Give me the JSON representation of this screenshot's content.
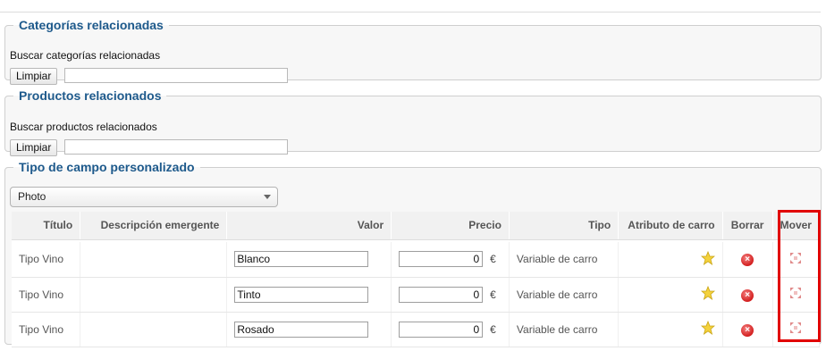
{
  "related_categories": {
    "legend": "Categorías relacionadas",
    "search_label": "Buscar categorías relacionadas",
    "clear_label": "Limpiar",
    "search_value": ""
  },
  "related_products": {
    "legend": "Productos relacionados",
    "search_label": "Buscar productos relacionados",
    "clear_label": "Limpiar",
    "search_value": ""
  },
  "custom_field": {
    "legend": "Tipo de campo personalizado",
    "selected_type": "Photo",
    "columns": {
      "title": "Título",
      "tooltip": "Descripción emergente",
      "value": "Valor",
      "price": "Precio",
      "type": "Tipo",
      "cart_attribute": "Atributo de carro",
      "delete": "Borrar",
      "move": "Mover"
    },
    "rows": [
      {
        "title": "Tipo Vino",
        "tooltip": "",
        "value": "Blanco",
        "price": "0",
        "currency": "€",
        "type": "Variable de carro"
      },
      {
        "title": "Tipo Vino",
        "tooltip": "",
        "value": "Tinto",
        "price": "0",
        "currency": "€",
        "type": "Variable de carro"
      },
      {
        "title": "Tipo Vino",
        "tooltip": "",
        "value": "Rosado",
        "price": "0",
        "currency": "€",
        "type": "Variable de carro"
      }
    ],
    "icons": {
      "cart_attribute": "star-icon",
      "delete": "delete-icon",
      "move": "move-icon"
    },
    "colors": {
      "legend": "#1e5a8c",
      "highlight_border": "#e10000"
    }
  }
}
